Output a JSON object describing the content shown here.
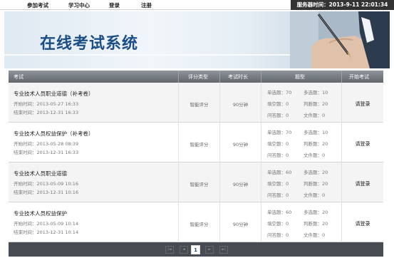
{
  "nav": {
    "items": [
      "参加考试",
      "学习中心",
      "登录",
      "注册"
    ]
  },
  "server_time": "服务器时间：2013-9-11 22:01:34",
  "banner": {
    "title": "在线考试系统"
  },
  "table": {
    "headers": [
      "考试",
      "评分类型",
      "考试时长",
      "题型",
      "开始考试"
    ],
    "rows": [
      {
        "name": "专业技术人员职业道德（补考卷）",
        "start": "开始时间：2013-05-27 16:33",
        "end": "结束时间：2013-12-31 16:33",
        "scoring": "智能评分",
        "duration": "90分钟",
        "types": {
          "single": "单选题：70",
          "multi": "多选题：10",
          "fill": "填空题：0",
          "judge": "判断题：20",
          "qa": "问答题：0",
          "file": "文件题：0"
        },
        "action": "请登录"
      },
      {
        "name": "专业技术人员权益保护（补考卷）",
        "start": "开始时间：2013-05-28 08:39",
        "end": "结束时间：2013-12-31 16:33",
        "scoring": "智能评分",
        "duration": "90分钟",
        "types": {
          "single": "单选题：70",
          "multi": "多选题：10",
          "fill": "填空题：0",
          "judge": "判断题：20",
          "qa": "问答题：0",
          "file": "文件题：0"
        },
        "action": "请登录"
      },
      {
        "name": "专业技术人员职业道德",
        "start": "开始时间：2013-05-09 10:16",
        "end": "结束时间：2013-12-31 10:16",
        "scoring": "智能评分",
        "duration": "90分钟",
        "types": {
          "single": "单选题：60",
          "multi": "多选题：20",
          "fill": "填空题：0",
          "judge": "判断题：20",
          "qa": "问答题：0",
          "file": "文件题：0"
        },
        "action": "请登录"
      },
      {
        "name": "专业技术人员权益保护",
        "start": "开始时间：2013-05-09 10:14",
        "end": "结束时间：2013-12-31 10:14",
        "scoring": "智能评分",
        "duration": "90分钟",
        "types": {
          "single": "单选题：60",
          "multi": "多选题：20",
          "fill": "填空题：0",
          "judge": "判断题：20",
          "qa": "问答题：0",
          "file": "文件题：0"
        },
        "action": "请登录"
      }
    ]
  },
  "pager": {
    "current": "1",
    "first": "|◄",
    "prev": "◄",
    "next": "►",
    "last": "►|"
  }
}
